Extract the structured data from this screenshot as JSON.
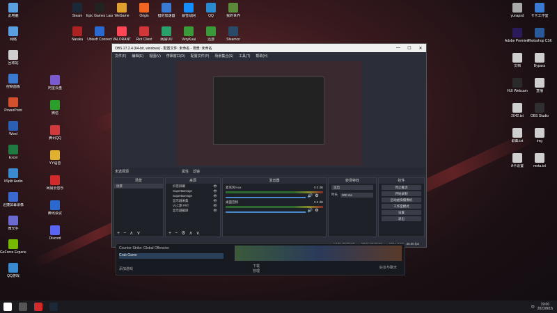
{
  "desktop": {
    "icons_left": [
      {
        "label": "此电脑",
        "color": "#5aa0e0"
      },
      {
        "label": "网络",
        "color": "#5aa0e0"
      },
      {
        "label": "回收站",
        "color": "#cfcfcf"
      },
      {
        "label": "控制面板",
        "color": "#3a7ad0"
      },
      {
        "label": "PowerPoint",
        "color": "#d2502d"
      },
      {
        "label": "Word",
        "color": "#2b5fb4"
      },
      {
        "label": "Excel",
        "color": "#1f7a3f"
      },
      {
        "label": "XSplit Audio",
        "color": "#3a8ad0"
      },
      {
        "label": "迅捷屏幕录像",
        "color": "#3a6ad0"
      },
      {
        "label": "微光手",
        "color": "#6a6ad0"
      },
      {
        "label": "GeForce Experience",
        "color": "#76b900"
      },
      {
        "label": "QQ游戏",
        "color": "#3a8ad0"
      }
    ],
    "icons_top": [
      {
        "label": "Steam",
        "color": "#1b2838"
      },
      {
        "label": "Epic Games Launcher",
        "color": "#222"
      },
      {
        "label": "WeGame",
        "color": "#e0a030"
      },
      {
        "label": "Origin",
        "color": "#f26522"
      },
      {
        "label": "猎豹加速器",
        "color": "#3a7ad0"
      },
      {
        "label": "暴雪战网",
        "color": "#148eff"
      },
      {
        "label": "QQ",
        "color": "#2a8ad0"
      },
      {
        "label": "我的世界",
        "color": "#5a8a3a"
      },
      {
        "label": "Naraka",
        "color": "#aa2222"
      },
      {
        "label": "Ubisoft Connect",
        "color": "#2a6ad0"
      },
      {
        "label": "VALORANT",
        "color": "#ff4655"
      },
      {
        "label": "Riot Client",
        "color": "#d13639"
      },
      {
        "label": "网易UU",
        "color": "#2aa06a"
      },
      {
        "label": "VeryKuai",
        "color": "#3a9a3a"
      },
      {
        "label": "迅游",
        "color": "#3a9a3a"
      },
      {
        "label": "Steamcn",
        "color": "#2a4a6a"
      }
    ],
    "icons_col2": [
      {
        "label": "阿里云盘",
        "color": "#7a5ad0"
      },
      {
        "label": "微信",
        "color": "#2aa02a"
      },
      {
        "label": "腾讯QQ",
        "color": "#d03a3a"
      },
      {
        "label": "YY语音",
        "color": "#e0b030"
      },
      {
        "label": "网易云音乐",
        "color": "#d02a2a"
      },
      {
        "label": "腾讯会议",
        "color": "#2a6ad0"
      },
      {
        "label": "Discord",
        "color": "#5865f2"
      }
    ],
    "icons_right": [
      {
        "label": "yunapsd",
        "color": "#aaaaaa"
      },
      {
        "label": "卡卡工作室",
        "color": "#3a7ad0"
      },
      {
        "label": "Adobe Premiere",
        "color": "#2a1a5a"
      },
      {
        "label": "Photoshop CS6",
        "color": "#2a5a9a"
      },
      {
        "label": "文档",
        "color": "#cfcfcf"
      },
      {
        "label": "Bypass",
        "color": "#cfcfcf"
      },
      {
        "label": "HUI Webcam",
        "color": "#2a2a2a"
      },
      {
        "label": "直播",
        "color": "#cfcfcf"
      },
      {
        "label": "2042.txt",
        "color": "#cfcfcf"
      },
      {
        "label": "OBS Studio",
        "color": "#302e31"
      },
      {
        "label": "歌曲.txt",
        "color": "#cfcfcf"
      },
      {
        "label": "img",
        "color": "#cfcfcf"
      },
      {
        "label": "A卡设置",
        "color": "#cfcfcf"
      },
      {
        "label": "meta.txt",
        "color": "#cfcfcf"
      }
    ]
  },
  "obs": {
    "title": "OBS 27.2.4 (64-bit, windows) - 配置文件: 未命名 - 场景: 未命名",
    "win_min": "—",
    "win_max": "☐",
    "win_close": "✕",
    "menu": [
      "文件(F)",
      "编辑(E)",
      "视图(V)",
      "停靠窗口(D)",
      "配置文件(P)",
      "场景集合(S)",
      "工具(T)",
      "帮助(H)"
    ],
    "scene_label": "未选择源",
    "scene_props": "属性",
    "scene_filters": "滤镜",
    "docks": {
      "scenes_title": "场景",
      "scenes": [
        "场景"
      ],
      "sources_title": "来源",
      "sources": [
        "抖音屏幕",
        "SuperBarrage",
        "SuperBarrage",
        "显示器采集",
        "VLC源 PRT",
        "显示器截屏"
      ],
      "mixer_title": "混音器",
      "mixer": [
        {
          "name": "麦克风/Aux",
          "db": "0.0 dB"
        },
        {
          "name": "桌面音频",
          "db": "0.0 dB"
        }
      ],
      "transitions_title": "转场特效",
      "transition_type": "淡出",
      "duration_label": "时长",
      "duration_value": "300 ms",
      "controls_title": "控件",
      "controls": [
        "停止推流",
        "开始录制",
        "启动虚拟摄像机",
        "工作室模式",
        "设置",
        "退出"
      ]
    },
    "status": {
      "live": "LIVE: 00:00:00",
      "rec": "REC: 00:00:00",
      "cpu": "CPU: 3.5%, 30.00 fps"
    }
  },
  "steam": {
    "row1": "Counter-Strike: Global Offensive",
    "row2": "Crab Game",
    "add_game": "添加游戏",
    "downloads": "下载",
    "manage": "管理",
    "friends": "好友与聊天"
  },
  "taskbar": {
    "time": "19:00",
    "date": "2022/8/15",
    "ime": "中",
    "apps": [
      {
        "name": "start",
        "color": "#ffffff"
      },
      {
        "name": "obs",
        "color": "#555555"
      },
      {
        "name": "netease",
        "color": "#d02a2a"
      },
      {
        "name": "steam",
        "color": "#1b2838"
      }
    ]
  }
}
